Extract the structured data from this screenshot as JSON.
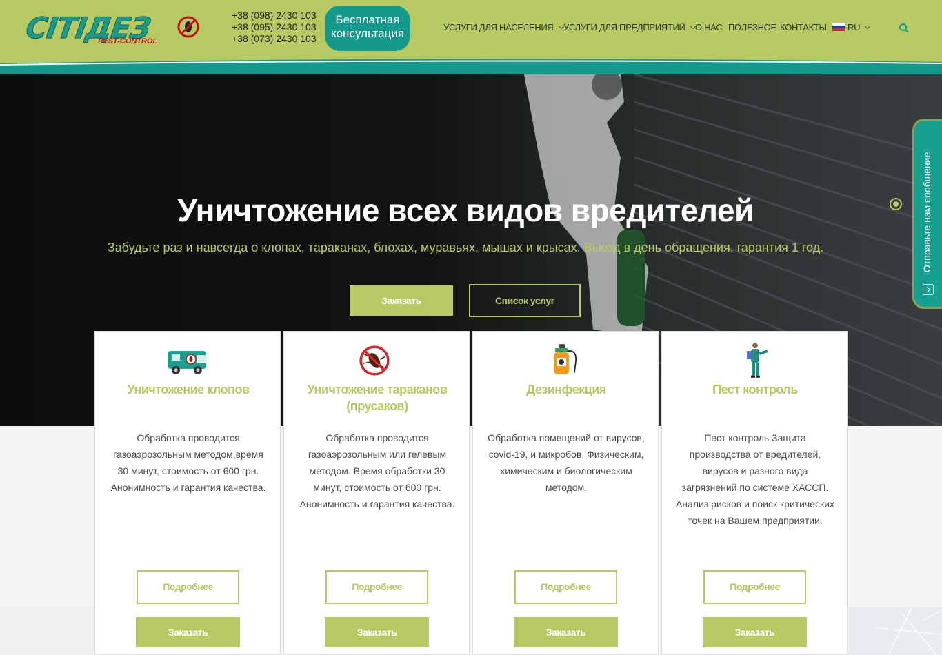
{
  "brand": {
    "logo_text": "CITIДЕЗ",
    "logo_sub": "PEST-CONTROL",
    "accent": "#b6c962",
    "teal": "#139a8c"
  },
  "header": {
    "phones": [
      "+38 (098) 2430 103",
      "+38 (095) 2430 103",
      "+38 (073) 2430 103"
    ],
    "consult_button": "Бесплатная консультация",
    "nav": [
      {
        "label": "УСЛУГИ ДЛЯ НАСЕЛЕНИЯ",
        "has_dropdown": true
      },
      {
        "label": "УСЛУГИ ДЛЯ ПРЕДПРИЯТИЙ",
        "has_dropdown": true
      },
      {
        "label": "О НАС",
        "has_dropdown": false
      },
      {
        "label": "ПОЛЕЗНОЕ",
        "has_dropdown": false
      },
      {
        "label": "КОНТАКТЫ",
        "has_dropdown": false
      },
      {
        "label": "RU",
        "has_dropdown": true,
        "icon": "russian-flag-icon"
      }
    ],
    "search_icon": "search-icon"
  },
  "hero": {
    "title": "Уничтожение всех видов вредителей",
    "subtitle": "Забудьте раз и навсегда о клопах, тараканах, блохах, муравьях, мышах и крысах. Выезд в день обращения, гарантия 1 год.",
    "order_button": "Заказать",
    "services_button": "Список услуг"
  },
  "side_tab": {
    "label": "Отправьте нам сообщение"
  },
  "cards": [
    {
      "icon": "van-icon",
      "title": "Уничтожение клопов",
      "text": "Обработка проводится газоаэрозольным методом,время 30 минут, стоимость от 600 грн. Анонимность и гарантия качества.",
      "more_button": "Подробнее",
      "order_button": "Заказать"
    },
    {
      "icon": "no-cockroach-icon",
      "title": "Уничтожение тараканов (прусаков)",
      "text": "Обработка проводится газоаэрозольным или гелевым методом. Время обработки 30 минут, стоимость от 600 грн. Анонимность и гарантия качества.",
      "more_button": "Подробнее",
      "order_button": "Заказать"
    },
    {
      "icon": "sprayer-icon",
      "title": "Дезинфекция",
      "text": "Обработка помещений от вирусов, covid-19, и микробов. Физическим, химическим и биологическим методом.",
      "more_button": "Подробнее",
      "order_button": "Заказать"
    },
    {
      "icon": "exterminator-icon",
      "title": "Пест контроль",
      "text": "Пест контроль Защита производства от вредителей, вирусов и разного вида загрязнений по системе ХАССП. Анализ рисков и поиск критических точек на Вашем предприятии.",
      "more_button": "Подробнее",
      "order_button": "Заказать"
    }
  ]
}
